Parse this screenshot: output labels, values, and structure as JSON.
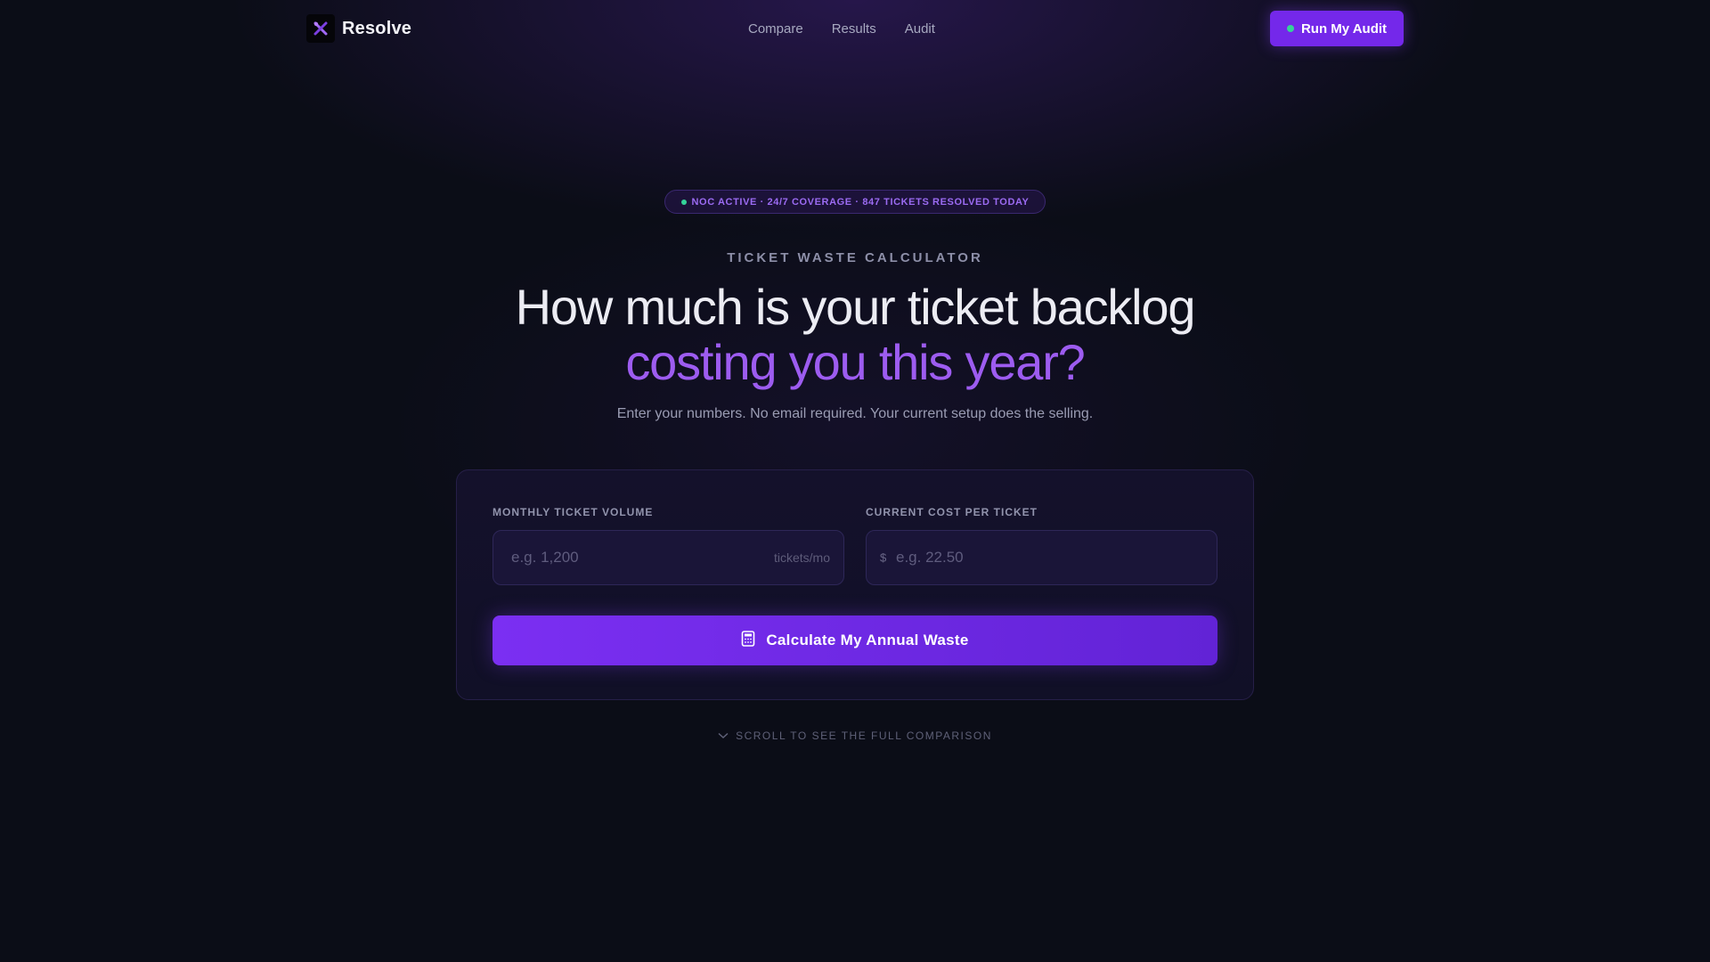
{
  "nav": {
    "brand": "Resolve",
    "links": [
      "Compare",
      "Results",
      "Audit"
    ],
    "cta_label": "Run My Audit"
  },
  "hero": {
    "status": "NOC ACTIVE · 24/7 COVERAGE · 847 TICKETS RESOLVED TODAY",
    "eyebrow": "TICKET WASTE CALCULATOR",
    "headline_line1": "How much is your ticket backlog",
    "headline_line2": "costing you this year?",
    "subtitle": "Enter your numbers. No email required. Your current setup does the selling."
  },
  "calculator": {
    "volume_label": "MONTHLY TICKET VOLUME",
    "volume_value": "",
    "volume_placeholder": "e.g. 1,200",
    "volume_suffix": "tickets/mo",
    "cost_label": "CURRENT COST PER TICKET",
    "cost_value": "",
    "cost_prefix": "$",
    "cost_placeholder": "e.g. 22.50",
    "submit_label": "Calculate My Annual Waste"
  },
  "scroll_hint": "SCROLL TO SEE THE FULL COMPARISON",
  "icons": {
    "logo": "crossed-tools-icon",
    "calculator": "calculator-icon",
    "scroll": "chevron-down-icon"
  },
  "colors": {
    "accent": "#7c3aed",
    "accent_text": "#9d5cf0",
    "status_green": "#34d399",
    "background": "#0b0d17"
  }
}
